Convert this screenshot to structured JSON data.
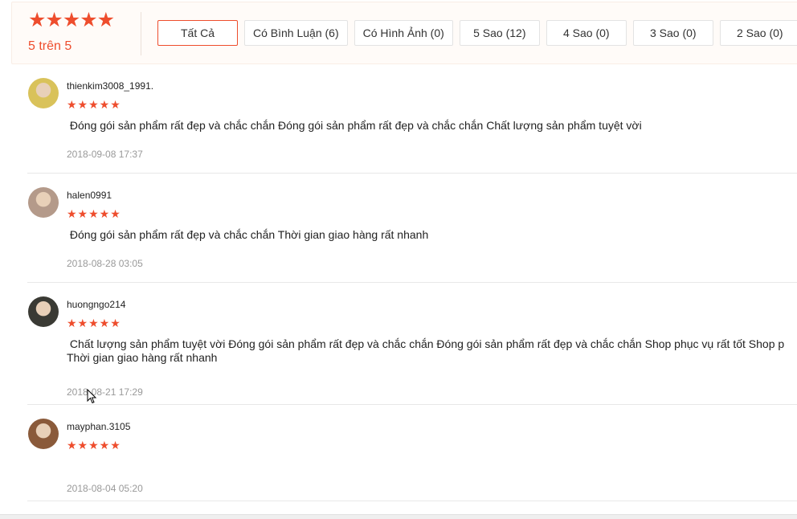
{
  "rating_overview": {
    "stars": 5,
    "score_text": "5 trên 5",
    "accent_color": "#ee4d2d"
  },
  "filters": [
    {
      "label": "Tất Cả",
      "active": true
    },
    {
      "label": "Có Bình Luận (6)",
      "active": false
    },
    {
      "label": "Có Hình Ảnh (0)",
      "active": false
    },
    {
      "label": "5 Sao (12)",
      "active": false
    },
    {
      "label": "4 Sao (0)",
      "active": false
    },
    {
      "label": "3 Sao (0)",
      "active": false
    },
    {
      "label": "2 Sao (0)",
      "active": false
    }
  ],
  "reviews": [
    {
      "username": "thienkim3008_1991.",
      "rating": 5,
      "comment": " Đóng gói sản phẩm rất đẹp và chắc chắn Đóng gói sản phẩm rất đẹp và chắc chắn Chất lượng sản phẩm tuyệt vời",
      "date": "2018-09-08 17:37",
      "avatar_color": "#d9c25a"
    },
    {
      "username": "halen0991",
      "rating": 5,
      "comment": " Đóng gói sản phẩm rất đẹp và chắc chắn Thời gian giao hàng rất nhanh",
      "date": "2018-08-28 03:05",
      "avatar_color": "#b49a8a"
    },
    {
      "username": "huongngo214",
      "rating": 5,
      "comment": " Chất lượng sản phẩm tuyệt vời Đóng gói sản phẩm rất đẹp và chắc chắn Đóng gói sản phẩm rất đẹp và chắc chắn Shop phục vụ rất tốt Shop p\nThời gian giao hàng rất nhanh",
      "date": "2018-08-21 17:29",
      "avatar_color": "#3a3a34"
    },
    {
      "username": "mayphan.3105",
      "rating": 5,
      "comment": "",
      "date": "2018-08-04 05:20",
      "avatar_color": "#8a5a3a"
    }
  ]
}
